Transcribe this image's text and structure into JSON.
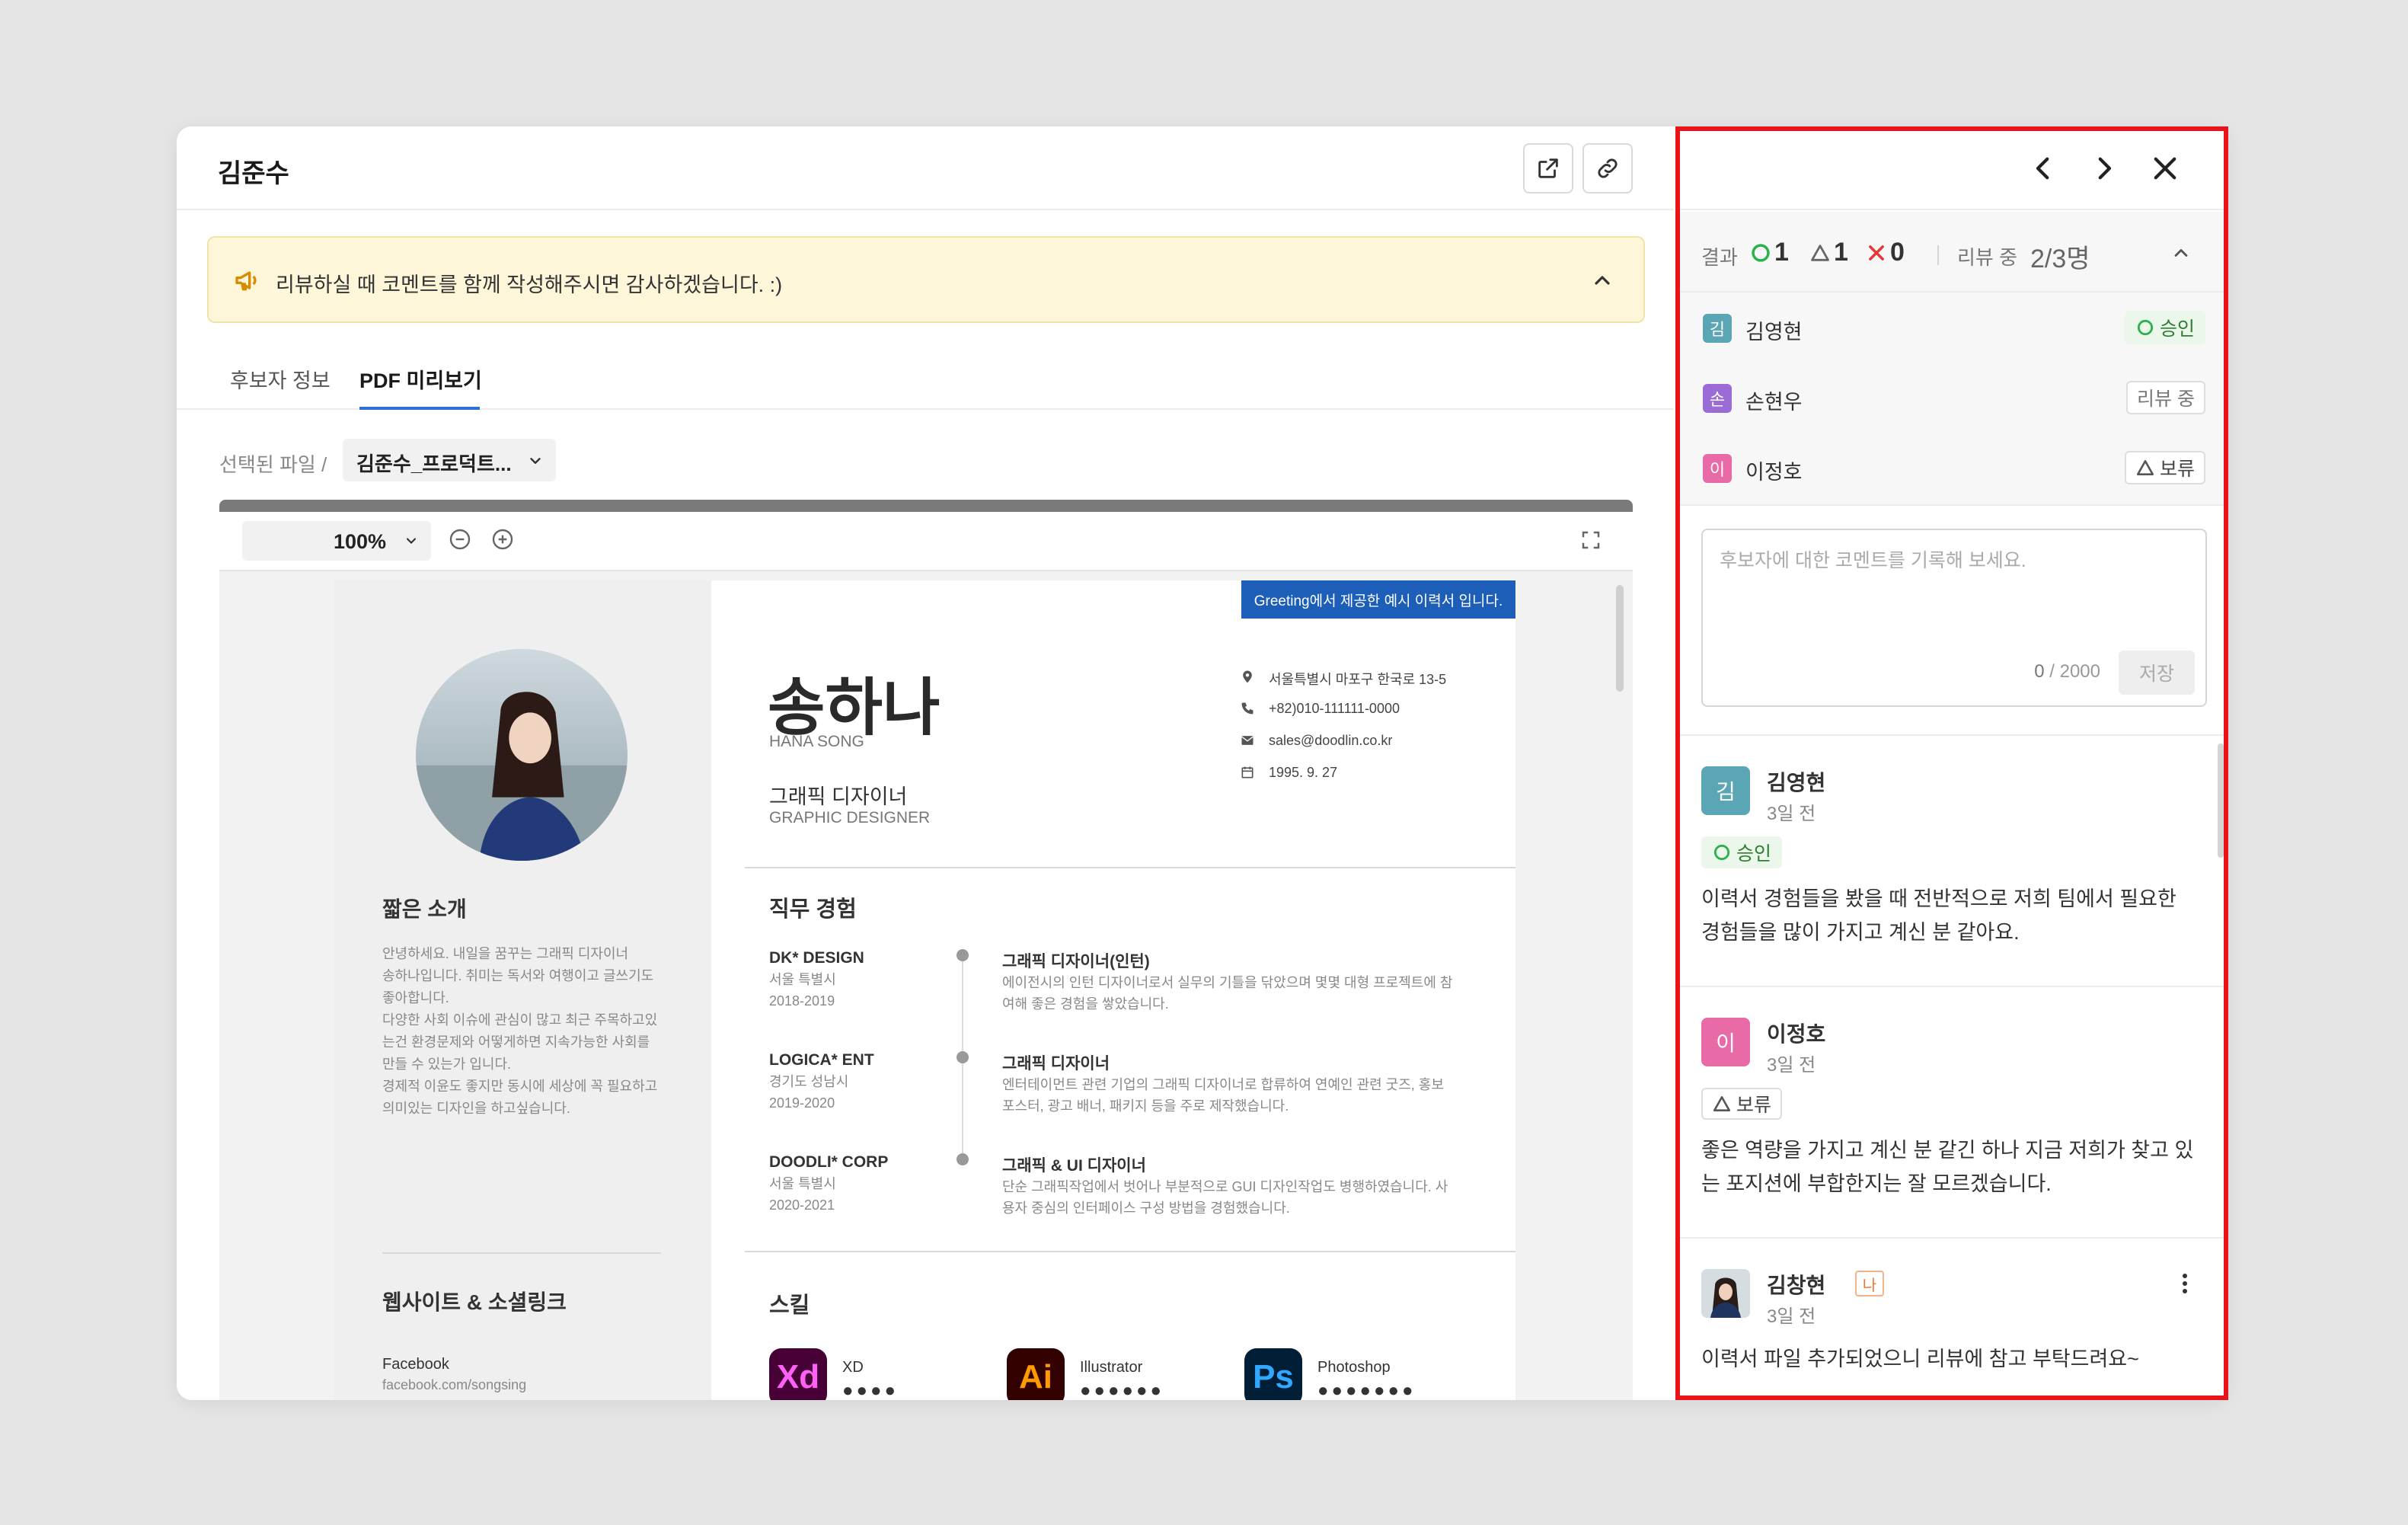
{
  "header": {
    "title": "김준수"
  },
  "notice": {
    "text": "리뷰하실 때 코멘트를 함께 작성해주시면 감사하겠습니다. :)"
  },
  "tabs": [
    {
      "label": "후보자 정보"
    },
    {
      "label": "PDF 미리보기"
    }
  ],
  "file": {
    "label": "선택된 파일 /",
    "selected": "김준수_프로덕트..."
  },
  "viewer": {
    "zoom": "100%"
  },
  "resume": {
    "banner": "Greeting에서 제공한 예시 이력서 입니다.",
    "name": "송하나",
    "name_en": "HANA SONG",
    "role": "그래픽 디자이너",
    "role_en": "GRAPHIC DESIGNER",
    "contacts": [
      {
        "icon": "location-icon",
        "text": "서울특별시 마포구 한국로 13-5"
      },
      {
        "icon": "phone-icon",
        "text": "+82)010-111111-0000"
      },
      {
        "icon": "mail-icon",
        "text": "sales@doodlin.co.kr"
      },
      {
        "icon": "calendar-icon",
        "text": "1995. 9. 27"
      }
    ],
    "intro_title": "짧은 소개",
    "intro_lines": [
      "안녕하세요. 내일을 꿈꾸는 그래픽 디자이너",
      "송하나입니다. 취미는 독서와 여행이고 글쓰기도",
      "좋아합니다.",
      "다양한 사회 이슈에 관심이 많고 최근 주목하고있",
      "는건 환경문제와 어떻게하면 지속가능한 사회를",
      "만들 수 있는가 입니다.",
      "경제적 이윤도 좋지만 동시에 세상에 꼭 필요하고",
      "의미있는 디자인을 하고싶습니다."
    ],
    "links_title": "웹사이트 & 소셜링크",
    "links": [
      {
        "name": "Facebook",
        "url": "facebook.com/songsing"
      }
    ],
    "experience_title": "직무 경험",
    "experience": [
      {
        "company": "DK* DESIGN",
        "location": "서울 특별시",
        "period": "2018-2019",
        "title": "그래픽 디자이너(인턴)",
        "desc": "에이전시의 인턴 디자이너로서 실무의 기틀을 닦았으며 몇몇 대형 프로젝트에 참여해 좋은 경험을 쌓았습니다."
      },
      {
        "company": "LOGICA* ENT",
        "location": "경기도 성남시",
        "period": "2019-2020",
        "title": "그래픽 디자이너",
        "desc": "엔터테이먼트 관련 기업의 그래픽 디자이너로 합류하여 연예인 관련 굿즈, 홍보 포스터, 광고 배너, 패키지 등을 주로 제작했습니다."
      },
      {
        "company": "DOODLI* CORP",
        "location": "서울 특별시",
        "period": "2020-2021",
        "title": "그래픽 & UI 디자이너",
        "desc": "단순 그래픽작업에서 벗어나 부분적으로 GUI 디자인작업도 병행하였습니다. 사용자 중심의 인터페이스 구성 방법을 경험했습니다."
      }
    ],
    "skills_title": "스킬",
    "skills": [
      {
        "icon": "Xd",
        "name": "XD",
        "dots": "●●●●",
        "bg": "#470137",
        "fg": "#ff61f6"
      },
      {
        "icon": "Ai",
        "name": "Illustrator",
        "dots": "●●●●●●",
        "bg": "#330000",
        "fg": "#ff9a00"
      },
      {
        "icon": "Ps",
        "name": "Photoshop",
        "dots": "●●●●●●●",
        "bg": "#001e36",
        "fg": "#31a8ff"
      }
    ]
  },
  "panel": {
    "summary": {
      "label": "결과",
      "approve": "1",
      "hold": "1",
      "reject": "0",
      "review_label": "리뷰 중",
      "review_count": "2/3명"
    },
    "reviewers": [
      {
        "initial": "김",
        "name": "김영현",
        "status": "승인",
        "color": "#5aa6b5"
      },
      {
        "initial": "손",
        "name": "손현우",
        "status": "리뷰 중",
        "color": "#9b6bd6"
      },
      {
        "initial": "이",
        "name": "이정호",
        "status": "보류",
        "color": "#e86aa6"
      }
    ],
    "comment": {
      "placeholder": "후보자에 대한 코멘트를 기록해 보세요.",
      "count": "0",
      "max": "/ 2000",
      "save": "저장"
    },
    "comments": [
      {
        "initial": "김",
        "name": "김영현",
        "time": "3일 전",
        "badge": "승인",
        "text": "이력서 경험들을 봤을 때 전반적으로 저희 팀에서 필요한 경험들을 많이 가지고 계신 분 같아요.",
        "color": "#5aa6b5"
      },
      {
        "initial": "이",
        "name": "이정호",
        "time": "3일 전",
        "badge": "보류",
        "text": "좋은 역량을 가지고 계신 분 같긴 하나 지금 저희가 찾고 있는 포지션에 부합한지는 잘 모르겠습니다.",
        "color": "#e86aa6"
      },
      {
        "name": "김창현",
        "me": "나",
        "time": "3일 전",
        "text": "이력서 파일 추가되었으니 리뷰에 참고 부탁드려요~"
      }
    ]
  },
  "colors": {
    "accent": "#2f6fd6",
    "approve": "#2bb24c",
    "reject": "#e53935",
    "highlight": "#e8141c"
  }
}
